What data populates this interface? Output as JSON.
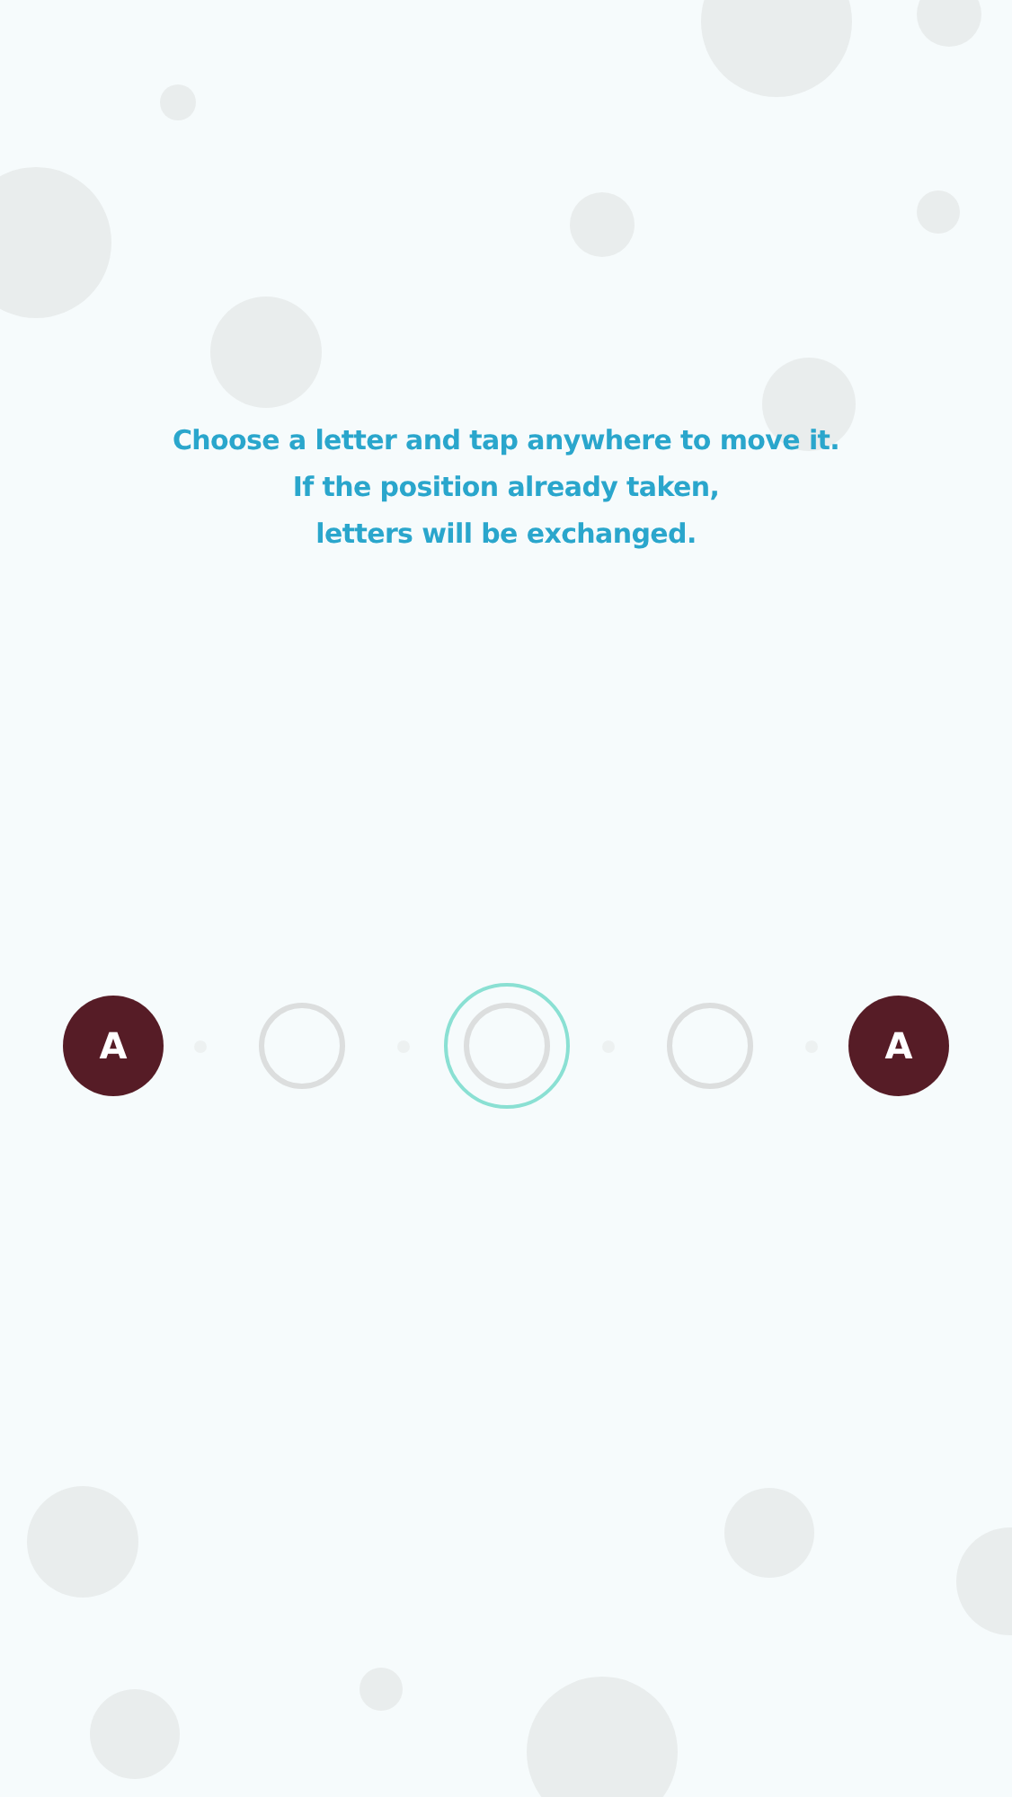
{
  "instructions": [
    "Choose a letter and tap anywhere to move it.",
    "If the position already taken,",
    "letters will be exchanged."
  ],
  "slots": [
    {
      "kind": "letter",
      "letter": "A",
      "selected": false
    },
    {
      "kind": "empty",
      "selected": false
    },
    {
      "kind": "empty",
      "selected": true
    },
    {
      "kind": "empty",
      "selected": false
    },
    {
      "kind": "letter",
      "letter": "A",
      "selected": false
    }
  ]
}
